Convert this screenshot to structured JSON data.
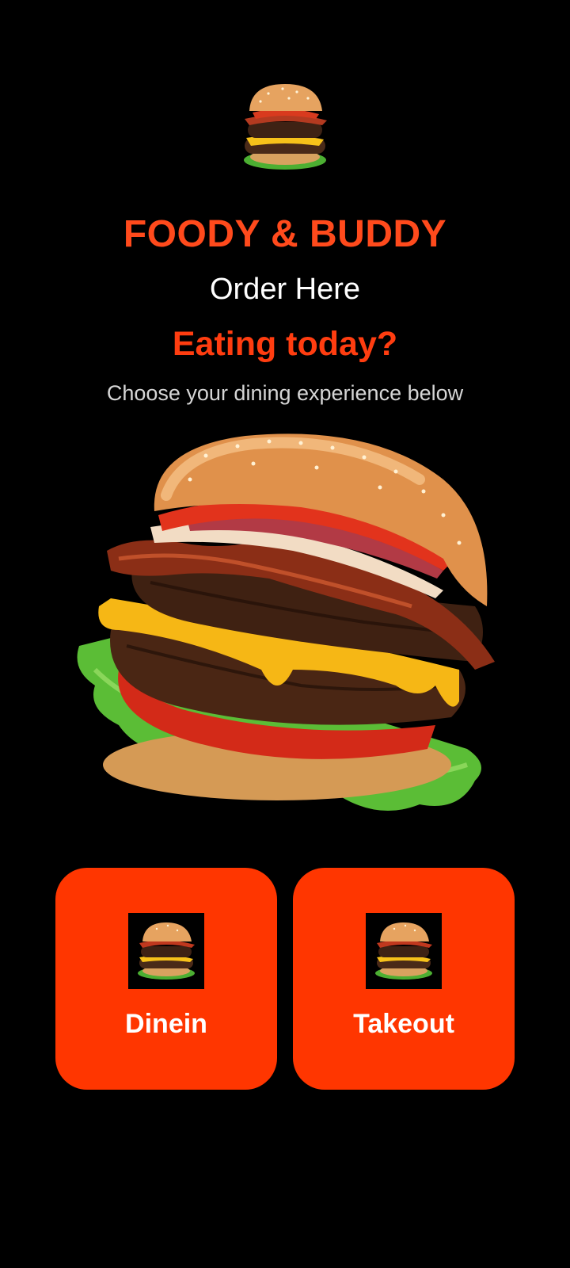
{
  "app": {
    "brand": "FOODY & BUDDY",
    "subtitle": "Order Here",
    "headline": "Eating today?",
    "description": "Choose your dining experience below"
  },
  "icons": {
    "logo": "burger-icon",
    "hero": "burger-image",
    "option_thumb": "burger-icon"
  },
  "options": [
    {
      "label": "Dinein"
    },
    {
      "label": "Takeout"
    }
  ],
  "colors": {
    "background": "#000000",
    "brand": "#ff4a1c",
    "headline": "#ff3d10",
    "button": "#ff3600",
    "text": "#ffffff"
  }
}
